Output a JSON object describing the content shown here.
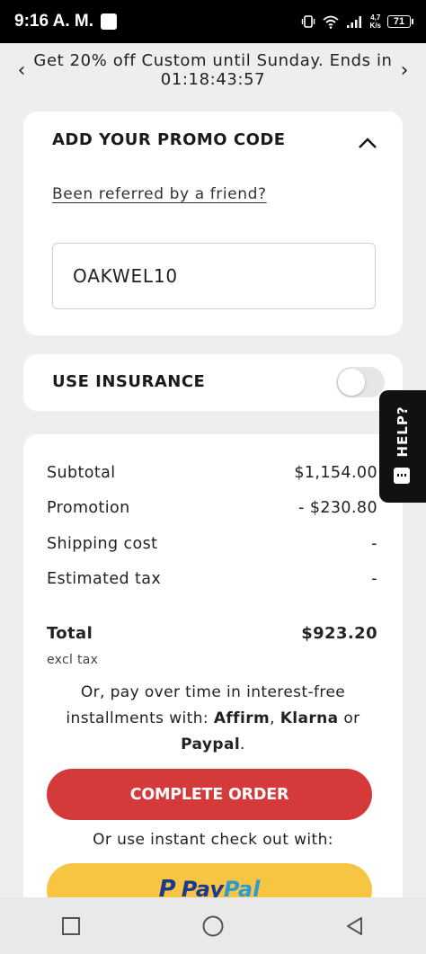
{
  "status_bar": {
    "time": "9:16 A. M.",
    "net_speed_value": "4,7",
    "net_speed_unit": "K/s",
    "battery": "71"
  },
  "promo_banner": {
    "line1": "Get 20% off Custom until Sunday. Ends in",
    "countdown": "01:18:43:57",
    "prev_icon": "chevron-left-icon",
    "next_icon": "chevron-right-icon"
  },
  "promo_card": {
    "title": "ADD YOUR PROMO CODE",
    "referral_link": "Been referred by a friend?",
    "code_value": "OAKWEL10"
  },
  "insurance": {
    "label": "USE INSURANCE",
    "enabled": false
  },
  "summary": {
    "subtotal_label": "Subtotal",
    "subtotal_value": "$1,154.00",
    "promotion_label": "Promotion",
    "promotion_value": "- $230.80",
    "shipping_label": "Shipping cost",
    "shipping_value": "-",
    "tax_label": "Estimated tax",
    "tax_value": "-",
    "total_label": "Total",
    "total_value": "$923.20",
    "excl_tax": "excl tax",
    "installments_prefix": "Or, pay over time in interest-free installments with: ",
    "installment_affirm": "Affirm",
    "installments_sep": ", ",
    "installment_klarna": "Klarna",
    "installments_or": " or ",
    "installment_paypal": "Paypal",
    "installments_end": ".",
    "complete_button": "COMPLETE ORDER",
    "instant_checkout": "Or use instant check out with:",
    "paypal_pay": "Pay",
    "paypal_pal": "Pal",
    "paypal_mark": "P"
  },
  "help_tab": {
    "label": "HELP?"
  },
  "colors": {
    "complete_button": "#d53a3a",
    "paypal_button": "#f7c542",
    "background": "#eeeeee"
  }
}
